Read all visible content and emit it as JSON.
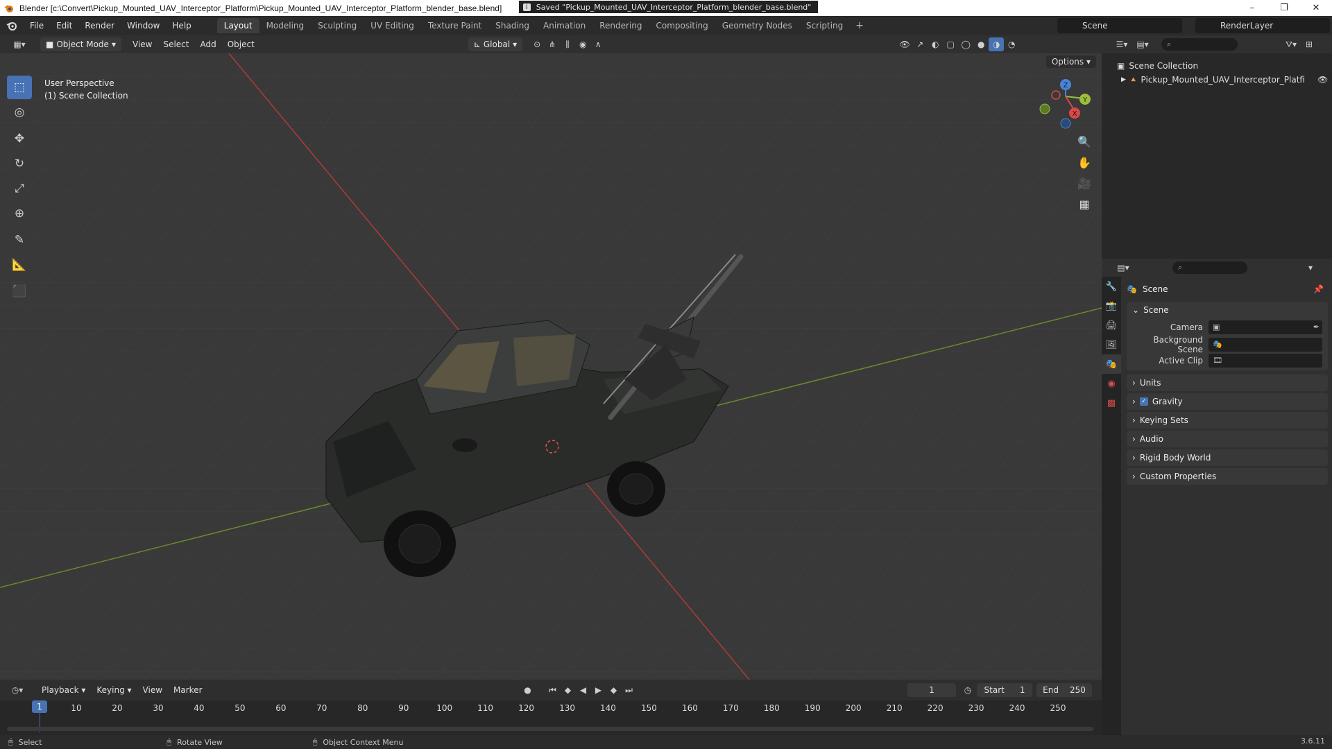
{
  "window": {
    "title": "Blender [c:\\Convert\\Pickup_Mounted_UAV_Interceptor_Platform\\Pickup_Mounted_UAV_Interceptor_Platform_blender_base.blend]",
    "controls": [
      "–",
      "❐",
      "✕"
    ]
  },
  "menu": [
    "File",
    "Edit",
    "Render",
    "Window",
    "Help"
  ],
  "workspaces": [
    "Layout",
    "Modeling",
    "Sculpting",
    "UV Editing",
    "Texture Paint",
    "Shading",
    "Animation",
    "Rendering",
    "Compositing",
    "Geometry Nodes",
    "Scripting"
  ],
  "active_workspace": "Layout",
  "scene_name": "Scene",
  "render_layer": "RenderLayer",
  "viewport_header": {
    "mode": "Object Mode",
    "menus": [
      "View",
      "Select",
      "Add",
      "Object"
    ],
    "orientation": "Global",
    "options": "Options"
  },
  "viewport": {
    "perspective": "User Perspective",
    "collection": "(1) Scene Collection",
    "gizmo": {
      "x": "X",
      "y": "Y",
      "z": "Z"
    }
  },
  "outliner": {
    "root": "Scene Collection",
    "items": [
      "Pickup_Mounted_UAV_Interceptor_Platfi"
    ]
  },
  "properties": {
    "context": "Scene",
    "panel": "Scene",
    "fields": [
      {
        "label": "Camera",
        "value": ""
      },
      {
        "label": "Background Scene",
        "value": ""
      },
      {
        "label": "Active Clip",
        "value": ""
      }
    ],
    "subpanels": [
      "Units",
      "Gravity",
      "Keying Sets",
      "Audio",
      "Rigid Body World",
      "Custom Properties"
    ],
    "gravity_checked": true
  },
  "timeline": {
    "menus": [
      "Playback",
      "Keying",
      "View",
      "Marker"
    ],
    "current_frame": "1",
    "start_label": "Start",
    "start": "1",
    "end_label": "End",
    "end": "250",
    "ticks": [
      "10",
      "20",
      "30",
      "40",
      "50",
      "60",
      "70",
      "80",
      "90",
      "100",
      "110",
      "120",
      "130",
      "140",
      "150",
      "160",
      "170",
      "180",
      "190",
      "200",
      "210",
      "220",
      "230",
      "240",
      "250"
    ]
  },
  "status": {
    "select": "Select",
    "rotate": "Rotate View",
    "context_menu": "Object Context Menu",
    "message": "Saved \"Pickup_Mounted_UAV_Interceptor_Platform_blender_base.blend\"",
    "version": "3.6.11"
  }
}
